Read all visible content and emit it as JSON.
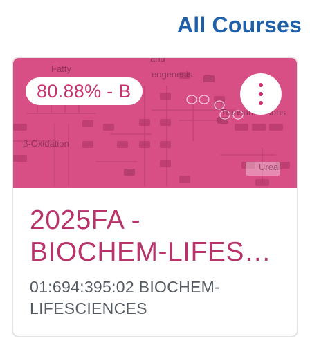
{
  "header": {
    "all_courses_link": "All Courses"
  },
  "course_card": {
    "grade": "80.88% - B",
    "title_lines": [
      "2025FA -",
      "BIOCHEM-LIFES…"
    ],
    "subtitle_lines": [
      "01:694:395:02 BIOCHEM-",
      "LIFESCIENCES"
    ],
    "image_labels": {
      "fatty": "Fatty",
      "and": "and",
      "gluconeogenesis": "eogenesis",
      "beta_oxidation": "β-Oxidation",
      "transamination": "Transamin",
      "transamination_tail": "ions",
      "urea": "Urea"
    },
    "menu_icon": "more-vertical-icon"
  },
  "colors": {
    "link": "#1f5fa8",
    "card_overlay": "#d84f86",
    "title": "#b8336a",
    "subtitle": "#555b61"
  }
}
